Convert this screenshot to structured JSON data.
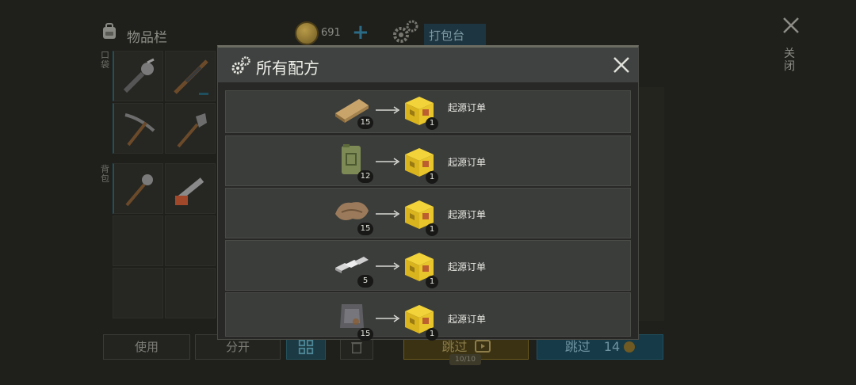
{
  "header": {
    "inventory_title": "物品栏",
    "coins": "691",
    "plus_label": "+",
    "pack_bench_label": "打包台",
    "close_label": "关闭"
  },
  "side_labels": {
    "hands": "口袋",
    "backpack": "背包"
  },
  "bottom_bar": {
    "use_label": "使用",
    "split_label": "分开",
    "skip_label": "跳过",
    "skip_counter": "10/10",
    "skip2_label": "跳过",
    "skip2_cost": "14"
  },
  "modal": {
    "title": "所有配方",
    "recipes": [
      {
        "ingredient_icon": "wood-plank-icon",
        "ingredient_count": "15",
        "output_icon": "yellow-crate-icon",
        "output_count": "1",
        "output_name": "起源订单"
      },
      {
        "ingredient_icon": "jerry-can-icon",
        "ingredient_count": "12",
        "output_icon": "yellow-crate-icon",
        "output_count": "1",
        "output_name": "起源订单"
      },
      {
        "ingredient_icon": "leather-icon",
        "ingredient_count": "15",
        "output_icon": "yellow-crate-icon",
        "output_count": "1",
        "output_name": "起源订单"
      },
      {
        "ingredient_icon": "metal-bars-icon",
        "ingredient_count": "5",
        "output_icon": "yellow-crate-icon",
        "output_count": "1",
        "output_name": "起源订单"
      },
      {
        "ingredient_icon": "iron-plate-icon",
        "ingredient_count": "15",
        "output_icon": "yellow-crate-icon",
        "output_count": "1",
        "output_name": "起源订单"
      }
    ]
  },
  "colors": {
    "accent_teal": "#2b6b86",
    "skip_gold": "#6d5b1c",
    "modal_header": "#3f4240"
  }
}
